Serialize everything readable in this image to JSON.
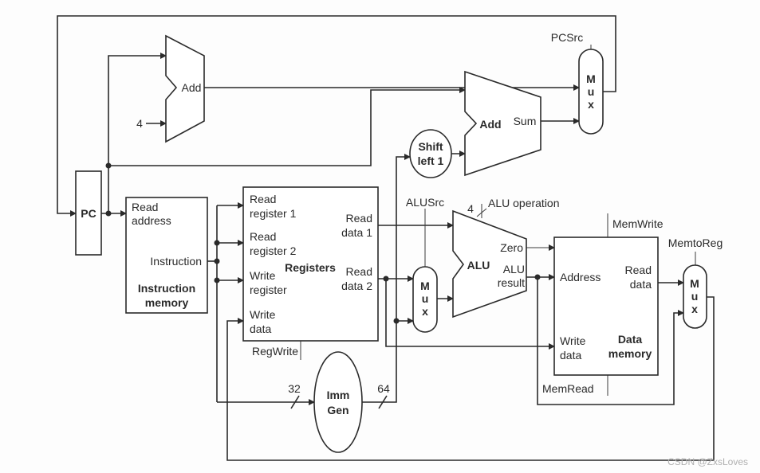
{
  "pc": {
    "label": "PC"
  },
  "adder_pc": {
    "label": "Add",
    "constant": "4"
  },
  "adder_branch": {
    "label": "Add",
    "output": "Sum"
  },
  "shift": {
    "line1": "Shift",
    "line2": "left 1"
  },
  "mux_label": [
    "M",
    "u",
    "x"
  ],
  "pcsrc": "PCSrc",
  "instruction_memory": {
    "read_address_1": "Read",
    "read_address_2": "address",
    "instruction": "Instruction",
    "title1": "Instruction",
    "title2": "memory"
  },
  "registers": {
    "read_reg1_a": "Read",
    "read_reg1_b": "register 1",
    "read_reg2_a": "Read",
    "read_reg2_b": "register 2",
    "write_reg_a": "Write",
    "write_reg_b": "register",
    "write_data_a": "Write",
    "write_data_b": "data",
    "read_data1_a": "Read",
    "read_data1_b": "data 1",
    "read_data2_a": "Read",
    "read_data2_b": "data 2",
    "title": "Registers",
    "control": "RegWrite"
  },
  "imm_gen": {
    "line1": "Imm",
    "line2": "Gen",
    "in_width": "32",
    "out_width": "64"
  },
  "alu": {
    "label": "ALU",
    "zero": "Zero",
    "result_a": "ALU",
    "result_b": "result",
    "alusrc": "ALUSrc",
    "op_width": "4",
    "operation": "ALU operation"
  },
  "data_memory": {
    "address": "Address",
    "read_data_a": "Read",
    "read_data_b": "data",
    "write_data_a": "Write",
    "write_data_b": "data",
    "title1": "Data",
    "title2": "memory",
    "memwrite": "MemWrite",
    "memread": "MemRead"
  },
  "memtoreg": "MemtoReg",
  "watermark": "CSDN @ZxsLoves"
}
